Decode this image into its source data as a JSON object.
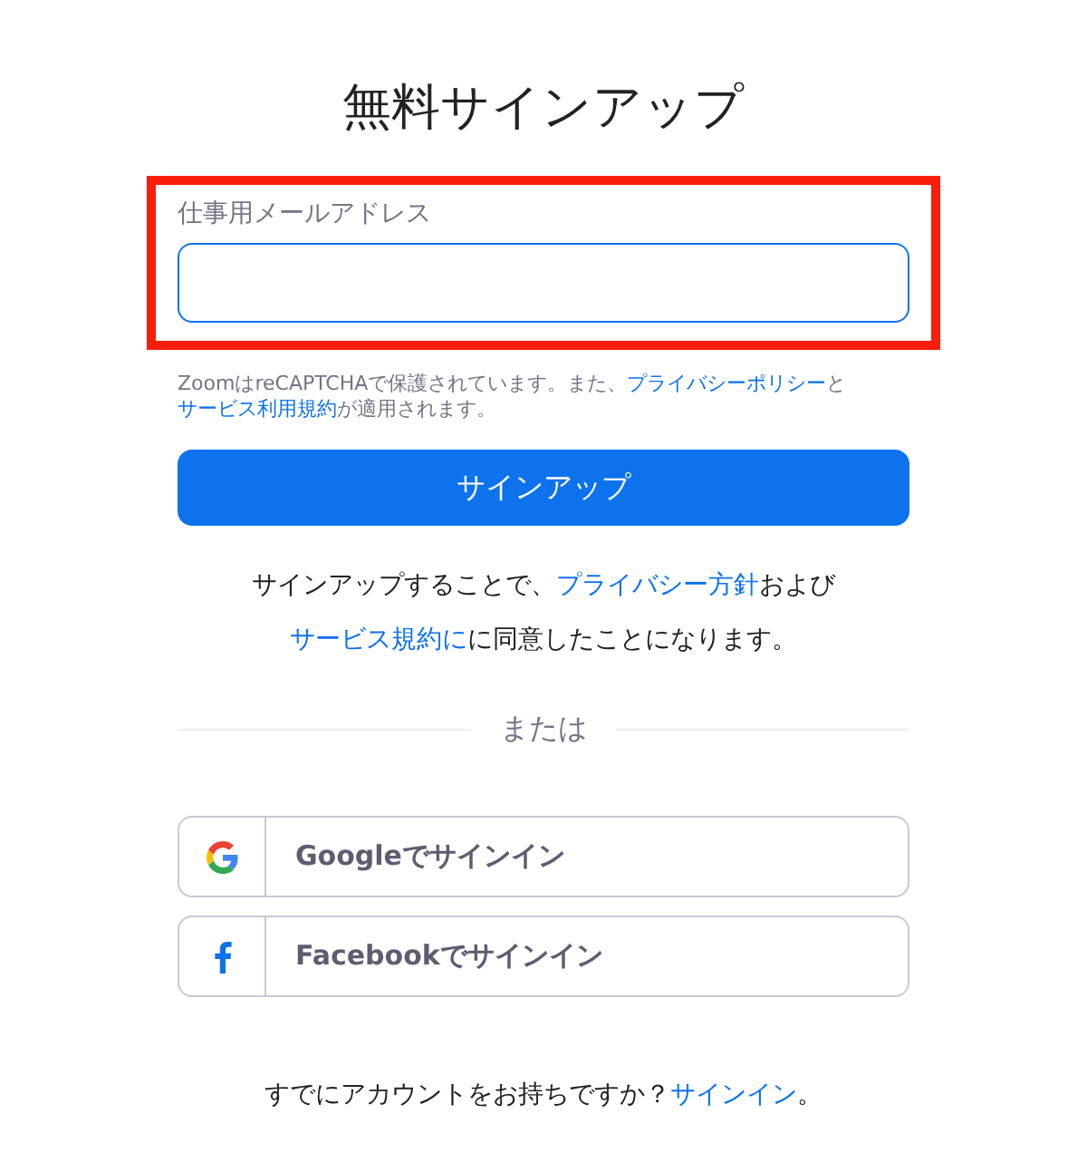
{
  "title": "無料サインアップ",
  "email_field": {
    "label": "仕事用メールアドレス",
    "highlighted": true
  },
  "recaptcha_note": [
    {
      "kind": "text",
      "text": "ZoomはreCAPTCHAで保護されています。また、"
    },
    {
      "kind": "link",
      "text": "プライバシーポリシー"
    },
    {
      "kind": "text",
      "text": "と"
    },
    {
      "kind": "link",
      "text": "サービス利用規約"
    },
    {
      "kind": "text",
      "text": "が適用されます。"
    }
  ],
  "signup_button": "サインアップ",
  "consent": [
    {
      "kind": "text",
      "text": "サインアップすることで、"
    },
    {
      "kind": "link",
      "text": "プライバシー方針"
    },
    {
      "kind": "text",
      "text": "および"
    },
    {
      "kind": "link",
      "text": "サービス規約に"
    },
    {
      "kind": "text",
      "text": "に同意したことになります。"
    }
  ],
  "divider_label": "または",
  "social_buttons": [
    {
      "kind": "google",
      "label": "Googleでサインイン"
    },
    {
      "kind": "facebook",
      "label": "Facebookでサインイン"
    }
  ],
  "footer": [
    {
      "kind": "text",
      "text": "すでにアカウントをお持ちですか？"
    },
    {
      "kind": "link",
      "text": "サインイン"
    },
    {
      "kind": "text",
      "text": "。"
    }
  ]
}
